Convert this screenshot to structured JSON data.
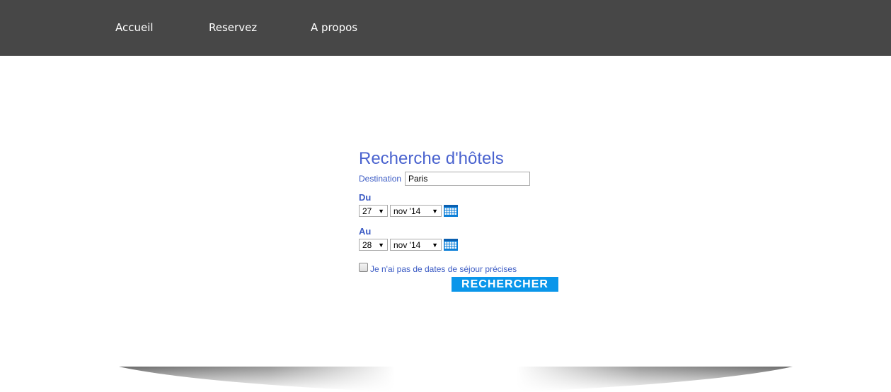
{
  "nav": {
    "items": [
      {
        "label": "Accueil"
      },
      {
        "label": "Reservez"
      },
      {
        "label": "A propos"
      }
    ]
  },
  "form": {
    "title": "Recherche d'hôtels",
    "destination_label": "Destination",
    "destination_value": "Paris",
    "from_label": "Du",
    "from_day": "27",
    "from_month": "nov '14",
    "to_label": "Au",
    "to_day": "28",
    "to_month": "nov '14",
    "no_dates_label": "Je n'ai pas de dates de séjour précises",
    "search_button": "RECHERCHER"
  },
  "icons": {
    "calendar": "calendar-icon",
    "dropdown": "chevron-down-icon"
  },
  "colors": {
    "nav_bg": "#474747",
    "accent_text": "#3b5bc4",
    "button_bg": "#0a96ea"
  }
}
